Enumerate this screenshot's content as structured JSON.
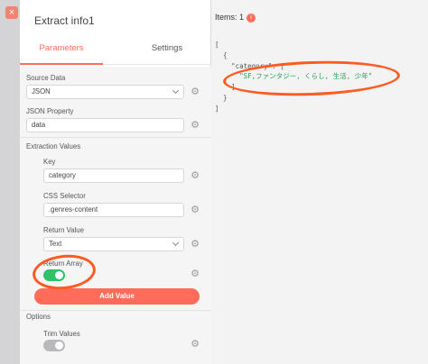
{
  "panel": {
    "title": "Extract info1",
    "tabs": [
      "Parameters",
      "Settings"
    ]
  },
  "fields": {
    "source_data_label": "Source Data",
    "source_data_value": "JSON",
    "json_property_label": "JSON Property",
    "json_property_value": "data",
    "extraction_values_label": "Extraction Values",
    "key_label": "Key",
    "key_value": "category",
    "css_selector_label": "CSS Selector",
    "css_selector_value": ".genres-content",
    "return_value_label": "Return Value",
    "return_value_value": "Text",
    "return_array_label": "Return Array",
    "add_value_label": "Add Value",
    "options_label": "Options",
    "trim_values_label": "Trim Values"
  },
  "output": {
    "items_label": "Items: 1",
    "info_icon": "i",
    "json_open_bracket": "[",
    "json_open_brace": "{",
    "json_key_line": "\"category\": [",
    "json_value": "\"SF,ファンタジー, くらし, 生活, 少年\"",
    "json_close_inner": "]",
    "json_close_brace": "}",
    "json_close_bracket": "]"
  },
  "background": {
    "close_icon": "×"
  },
  "colors": {
    "accent": "#ff6d5a",
    "toggle_on": "#2fc26a",
    "annotation": "#ff5a1f"
  }
}
